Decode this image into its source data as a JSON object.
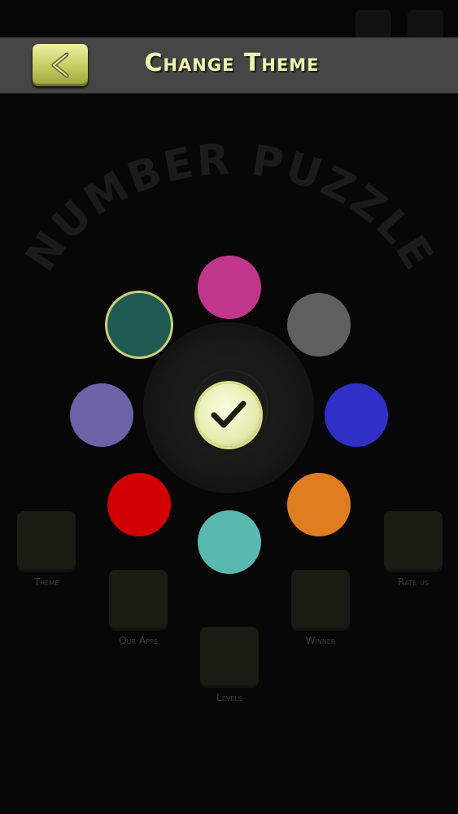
{
  "header": {
    "title": "Change Theme",
    "back_icon": "chevron-left-icon"
  },
  "background": {
    "arc_title": "NUMBER PUZZLE"
  },
  "menu": {
    "themes_label": "Theme",
    "our_apps_label": "Our Apps",
    "levels_label": "Levels",
    "winner_label": "Winner",
    "rate_us_label": "Rate us"
  },
  "theme_swatches": [
    {
      "name": "dark-teal",
      "color": "#1e5a50",
      "selected": true
    },
    {
      "name": "magenta",
      "color": "#c1378c",
      "selected": false
    },
    {
      "name": "gray",
      "color": "#5f5e60",
      "selected": false
    },
    {
      "name": "blue",
      "color": "#3030c6",
      "selected": false
    },
    {
      "name": "orange",
      "color": "#e07d20",
      "selected": false
    },
    {
      "name": "turquoise",
      "color": "#5ab8b2",
      "selected": false
    },
    {
      "name": "red",
      "color": "#d20000",
      "selected": false
    },
    {
      "name": "lavender",
      "color": "#6b63a8",
      "selected": false
    }
  ],
  "colors": {
    "header_bg": "#474646",
    "accent": "#eef4b0"
  }
}
